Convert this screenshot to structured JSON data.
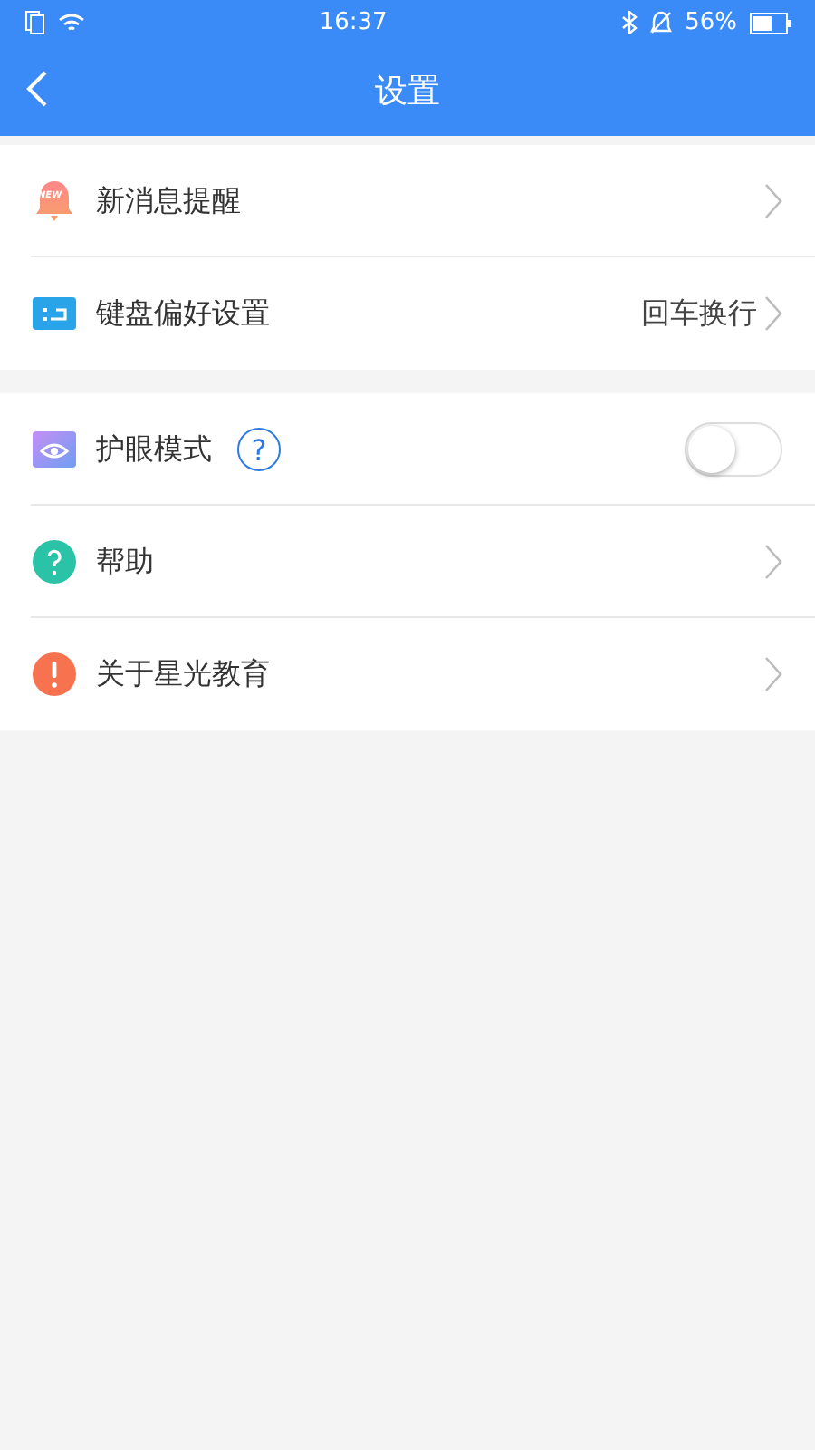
{
  "status_bar": {
    "time": "16:37",
    "battery": "56%"
  },
  "header": {
    "title": "设置"
  },
  "groups": [
    {
      "rows": [
        {
          "kind": "link",
          "badge": "NEW",
          "label": "新消息提醒"
        },
        {
          "kind": "link",
          "label": "键盘偏好设置",
          "value": "回车换行"
        }
      ]
    },
    {
      "rows": [
        {
          "kind": "toggle",
          "label": "护眼模式",
          "help": "?",
          "on": false
        },
        {
          "kind": "link",
          "label": "帮助"
        },
        {
          "kind": "link",
          "label": "关于星光教育"
        }
      ]
    }
  ]
}
